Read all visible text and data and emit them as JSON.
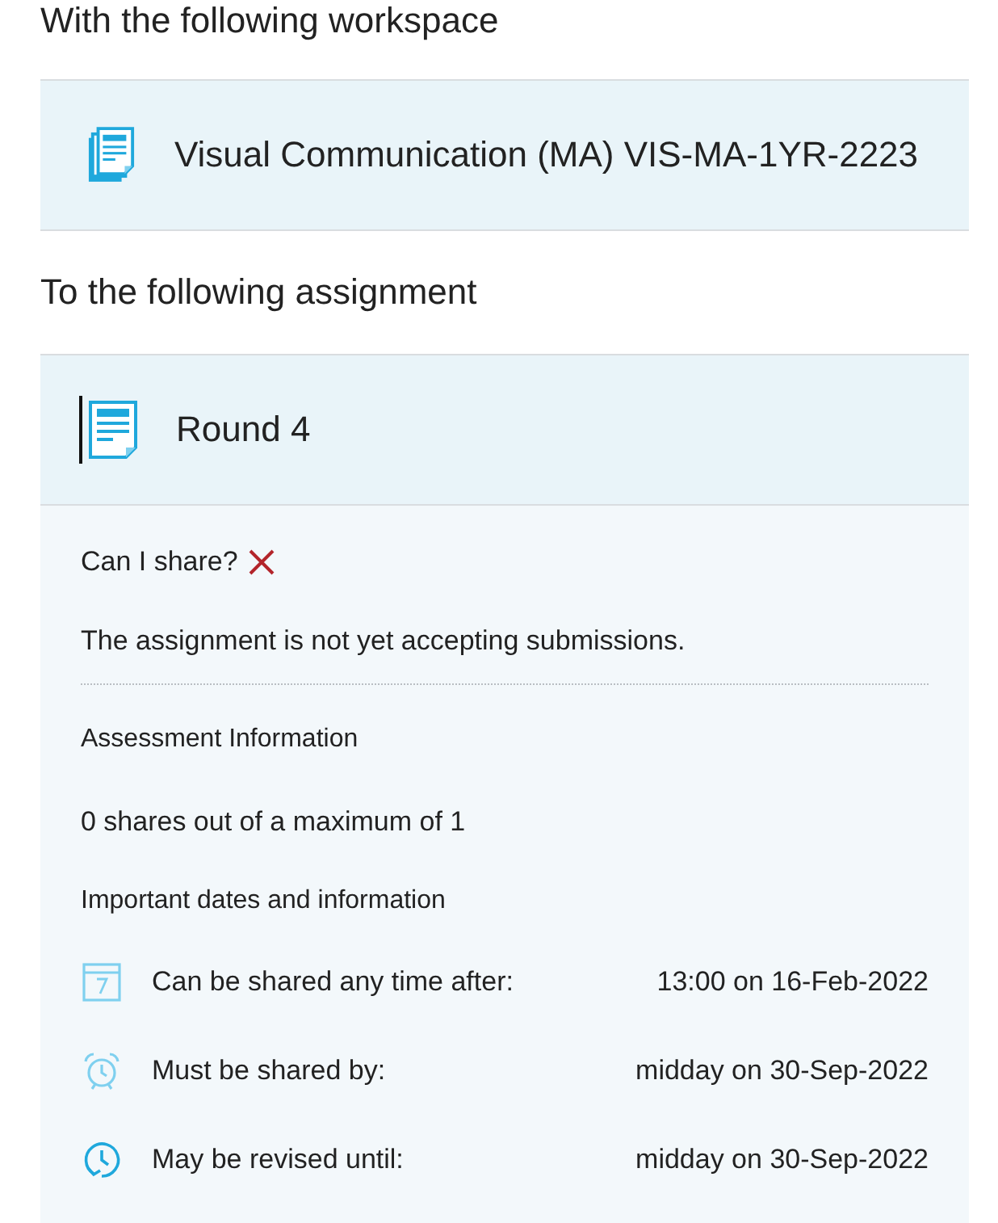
{
  "workspace_heading": "With the following workspace",
  "workspace": {
    "name": "Visual Communication (MA) VIS-MA-1YR-2223"
  },
  "assignment_heading": "To the following assignment",
  "assignment": {
    "title": "Round 4",
    "focused": true,
    "can_share": {
      "label": "Can I share?",
      "allowed": false
    },
    "status_message": "The assignment is not yet accepting submissions.",
    "assessment_heading": "Assessment Information",
    "shares_info": "0 shares out of a maximum of 1",
    "dates_heading": "Important dates and information",
    "dates": [
      {
        "kind": "calendar",
        "label": "Can be shared any time after:",
        "value": "13:00 on 16-Feb-2022"
      },
      {
        "kind": "alarm",
        "label": "Must be shared by:",
        "value": "midday on 30-Sep-2022"
      },
      {
        "kind": "revision",
        "label": "May be revised until:",
        "value": "midday on 30-Sep-2022"
      }
    ]
  }
}
